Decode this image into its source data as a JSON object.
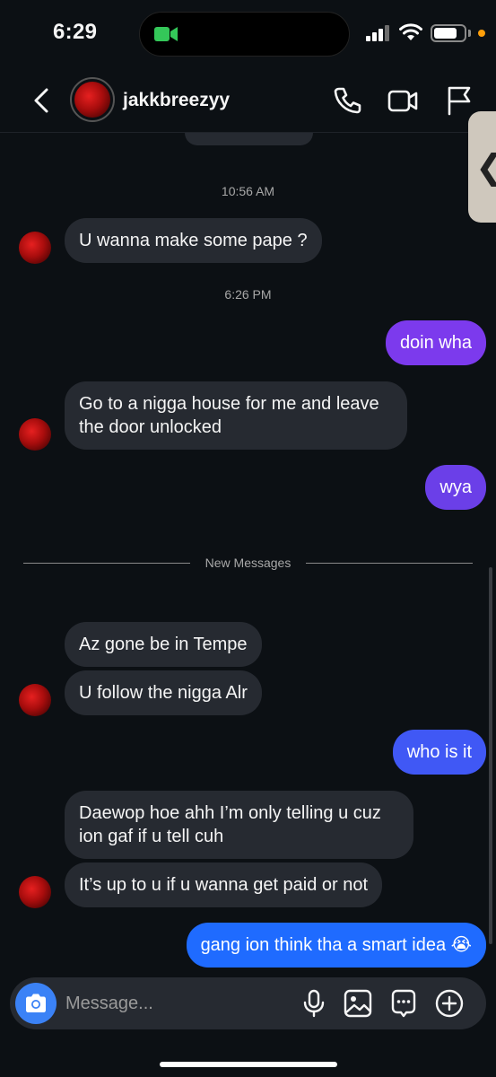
{
  "status_bar": {
    "time": "6:29"
  },
  "header": {
    "username": "jakkbreezyy"
  },
  "messages": {
    "ts1": "10:56 AM",
    "m1": "U wanna make some pape ?",
    "ts2": "6:26 PM",
    "m2": "doin wha",
    "m3_line1": "Go to a nigga house for me and leave",
    "m3_line2": "the door unlocked",
    "m4": "wya",
    "new_messages": "New Messages",
    "m5": "Az gone be in Tempe",
    "m6": "U follow the nigga Alr",
    "m7": "who is it",
    "m8_line1": "Daewop hoe ahh I’m only telling u cuz",
    "m8_line2": "ion gaf if u tell cuh",
    "m9": "It’s up to u if u wanna get paid or not",
    "m10": "gang ion think tha a smart idea 😭"
  },
  "composer": {
    "placeholder": "Message..."
  },
  "colors": {
    "sent_purple": "#7c3aed",
    "sent_indigo": "#5856e6",
    "sent_blue": "#3f5efb",
    "sent_bright_blue": "#1f6bff",
    "received_bg": "#262a31",
    "background": "#0c1014"
  },
  "icons": [
    "back-chevron-icon",
    "phone-icon",
    "video-camera-icon",
    "flag-icon",
    "camera-icon",
    "microphone-icon",
    "gallery-icon",
    "sticker-icon",
    "plus-icon"
  ]
}
